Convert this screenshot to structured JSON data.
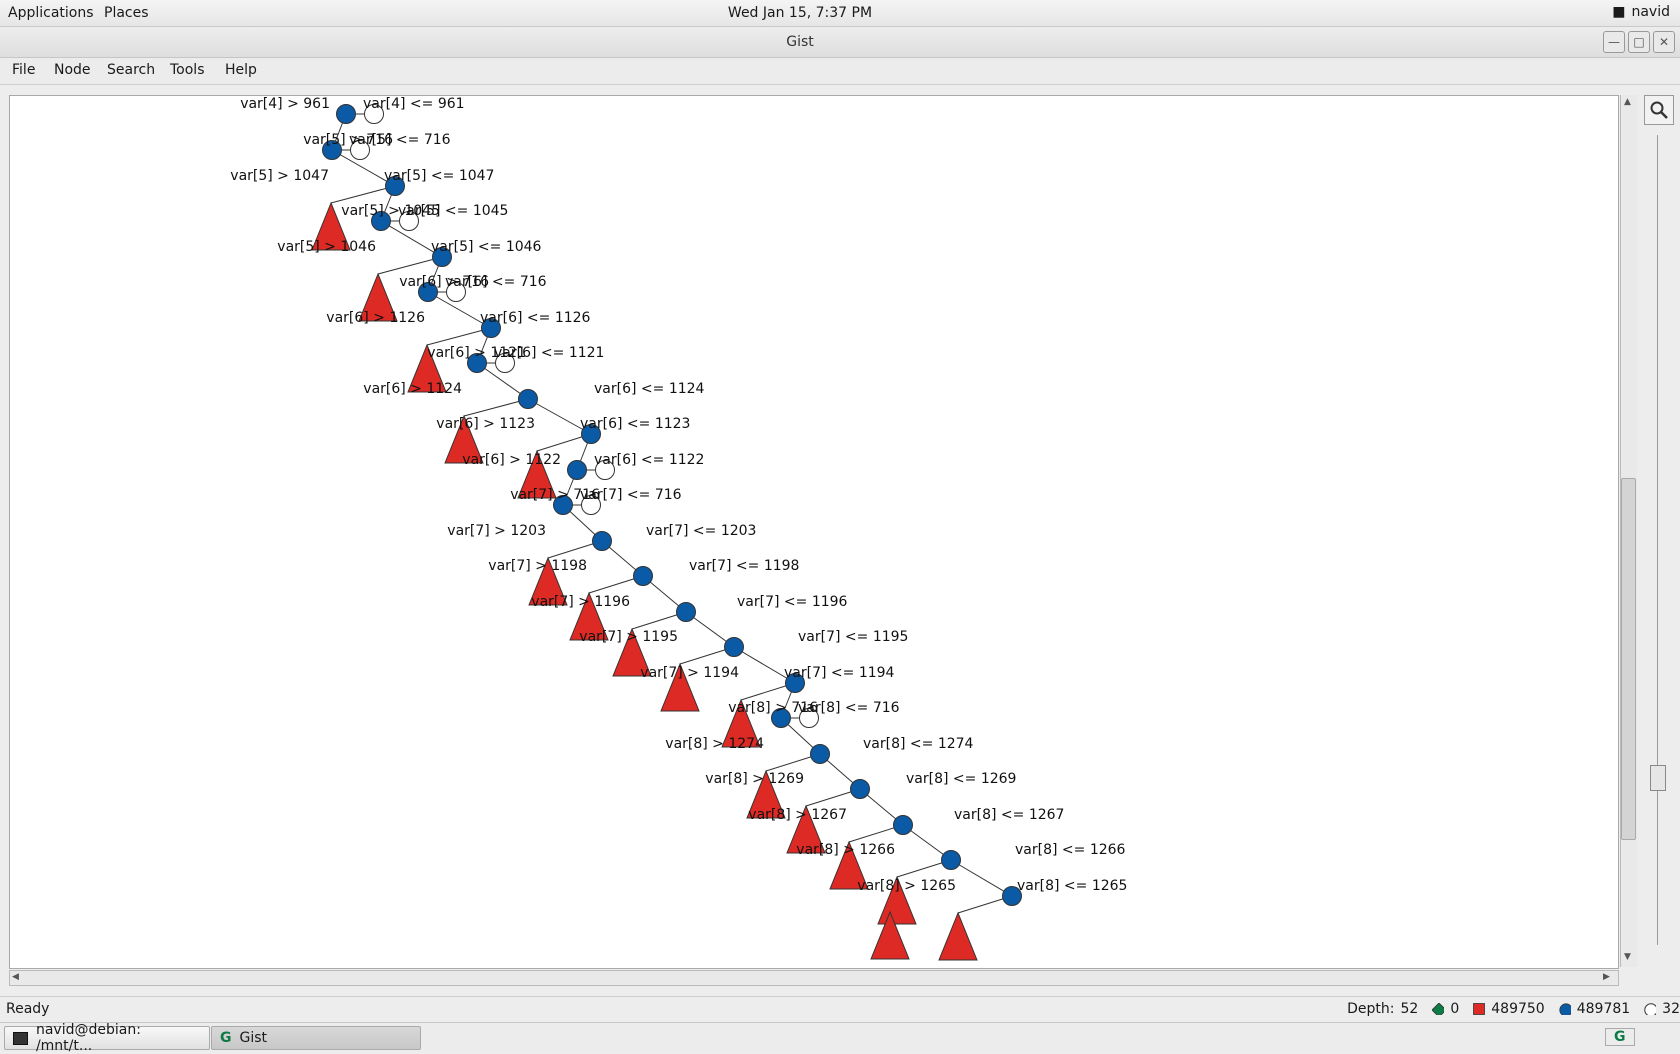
{
  "topbar": {
    "applications": "Applications",
    "places": "Places",
    "clock": "Wed Jan 15,  7:37 PM",
    "user": "navid"
  },
  "window": {
    "title": "Gist"
  },
  "menu": {
    "file": "File",
    "node": "Node",
    "search": "Search",
    "tools": "Tools",
    "help": "Help"
  },
  "status": {
    "text": "Ready",
    "depth_label": "Depth:",
    "depth": "52",
    "solutions": "0",
    "failed": "489750",
    "choices": "489781",
    "open": "32"
  },
  "taskbar": {
    "terminal": "navid@debian: /mnt/t...",
    "gist": "Gist"
  },
  "colors": {
    "choice": "#0b5aa5",
    "failed": "#dd2a24",
    "solution": "#0e7a45"
  },
  "icons": {
    "zoom": "magnifier-icon",
    "notification": "chat-icon"
  },
  "tree": {
    "nodes": [
      {
        "type": "choice",
        "left": "var[4] > 961",
        "right": "var[4] <= 961",
        "open": true
      },
      {
        "type": "choice",
        "left": "var[5] > 716",
        "right": "var[5] <= 716",
        "open": true
      },
      {
        "type": "choice",
        "left": "var[5] > 1047",
        "right": "var[5] <= 1047",
        "open": false
      },
      {
        "type": "choice",
        "left": "var[5] > 1045",
        "right": "var[5] <= 1045",
        "open": true
      },
      {
        "type": "choice",
        "left": "var[5] > 1046",
        "right": "var[5] <= 1046",
        "open": false
      },
      {
        "type": "choice",
        "left": "var[6] > 716",
        "right": "var[6] <= 716",
        "open": true
      },
      {
        "type": "choice",
        "left": "var[6] > 1126",
        "right": "var[6] <= 1126",
        "open": false
      },
      {
        "type": "choice",
        "left": "var[6] > 1121",
        "right": "var[6] <= 1121",
        "open": true
      },
      {
        "type": "choice",
        "left": "var[6] > 1124",
        "right": "var[6] <= 1124",
        "open": false
      },
      {
        "type": "choice",
        "left": "var[6] > 1123",
        "right": "var[6] <= 1123",
        "open": false
      },
      {
        "type": "choice",
        "left": "var[6] > 1122",
        "right": "var[6] <= 1122",
        "open": true
      },
      {
        "type": "choice",
        "left": "var[7] > 716",
        "right": "var[7] <= 716",
        "open": true
      },
      {
        "type": "choice",
        "left": "var[7] > 1203",
        "right": "var[7] <= 1203",
        "open": false
      },
      {
        "type": "choice",
        "left": "var[7] > 1198",
        "right": "var[7] <= 1198",
        "open": false
      },
      {
        "type": "choice",
        "left": "var[7] > 1196",
        "right": "var[7] <= 1196",
        "open": false
      },
      {
        "type": "choice",
        "left": "var[7] > 1195",
        "right": "var[7] <= 1195",
        "open": false
      },
      {
        "type": "choice",
        "left": "var[7] > 1194",
        "right": "var[7] <= 1194",
        "open": false
      },
      {
        "type": "choice",
        "left": "var[8] > 716",
        "right": "var[8] <= 716",
        "open": true
      },
      {
        "type": "choice",
        "left": "var[8] > 1274",
        "right": "var[8] <= 1274",
        "open": false
      },
      {
        "type": "choice",
        "left": "var[8] > 1269",
        "right": "var[8] <= 1269",
        "open": false
      },
      {
        "type": "choice",
        "left": "var[8] > 1267",
        "right": "var[8] <= 1267",
        "open": false
      },
      {
        "type": "choice",
        "left": "var[8] > 1266",
        "right": "var[8] <= 1266",
        "open": false
      },
      {
        "type": "choice",
        "left": "var[8] > 1265",
        "right": "var[8] <= 1265",
        "open": false
      }
    ]
  }
}
